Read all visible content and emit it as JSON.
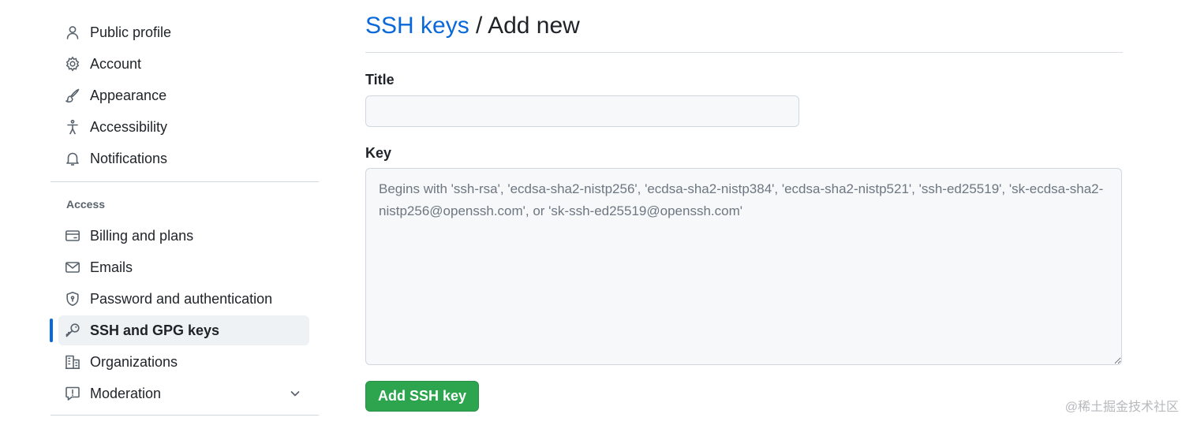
{
  "sidebar": {
    "items": [
      {
        "label": "Public profile",
        "icon": "person-icon"
      },
      {
        "label": "Account",
        "icon": "gear-icon"
      },
      {
        "label": "Appearance",
        "icon": "paintbrush-icon"
      },
      {
        "label": "Accessibility",
        "icon": "accessibility-icon"
      },
      {
        "label": "Notifications",
        "icon": "bell-icon"
      }
    ],
    "access_heading": "Access",
    "access_items": [
      {
        "label": "Billing and plans",
        "icon": "credit-card-icon"
      },
      {
        "label": "Emails",
        "icon": "mail-icon"
      },
      {
        "label": "Password and authentication",
        "icon": "shield-lock-icon"
      },
      {
        "label": "SSH and GPG keys",
        "icon": "key-icon",
        "active": true
      },
      {
        "label": "Organizations",
        "icon": "organization-icon"
      },
      {
        "label": "Moderation",
        "icon": "report-icon",
        "expandable": true
      }
    ]
  },
  "main": {
    "breadcrumb": "SSH keys",
    "separator": " / ",
    "heading": "Add new",
    "title_label": "Title",
    "title_value": "",
    "key_label": "Key",
    "key_value": "",
    "key_placeholder": "Begins with 'ssh-rsa', 'ecdsa-sha2-nistp256', 'ecdsa-sha2-nistp384', 'ecdsa-sha2-nistp521', 'ssh-ed25519', 'sk-ecdsa-sha2-nistp256@openssh.com', or 'sk-ssh-ed25519@openssh.com'",
    "submit_label": "Add SSH key"
  },
  "watermark": "@稀土掘金技术社区",
  "colors": {
    "link": "#0969da",
    "active_indicator": "#0969da",
    "primary_button": "#2da44e",
    "input_background": "#f6f8fa"
  }
}
